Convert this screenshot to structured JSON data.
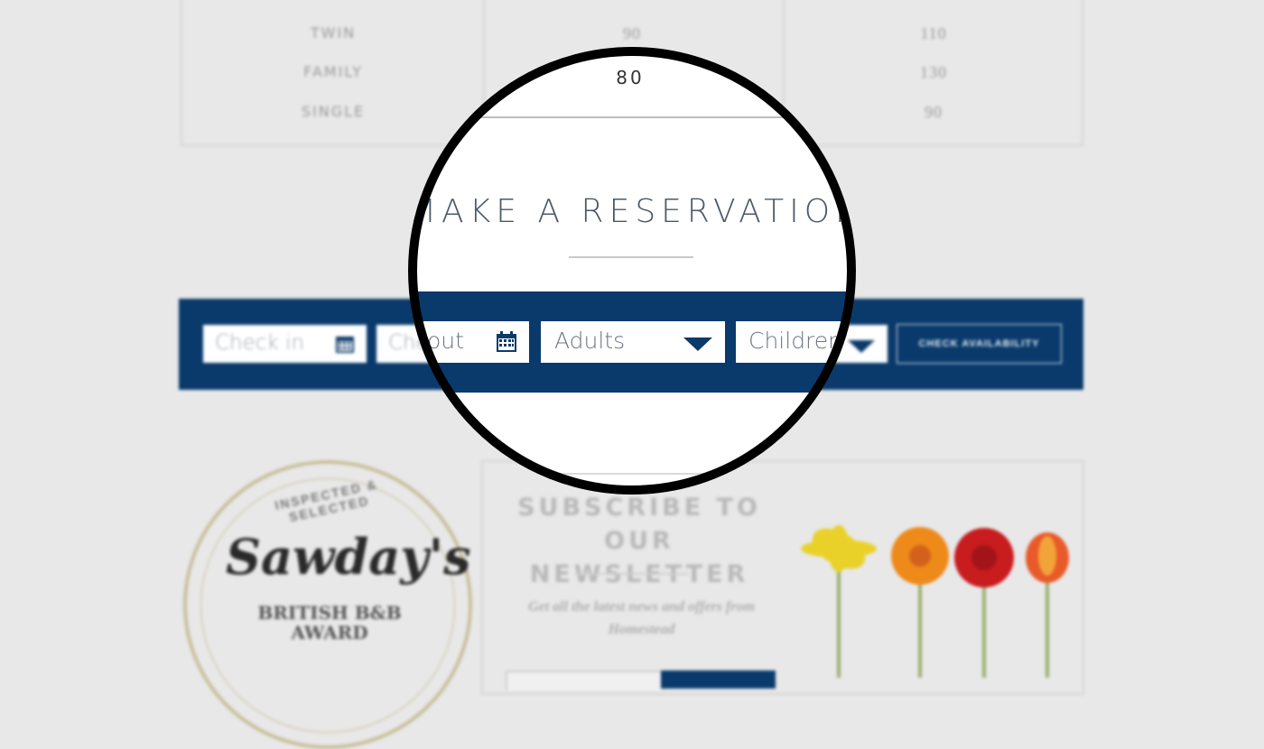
{
  "rates": {
    "rows": [
      {
        "room": "TWIN",
        "price1": "90",
        "price2": "110"
      },
      {
        "room": "FAMILY",
        "price1": "",
        "price2": "130"
      },
      {
        "room": "SINGLE",
        "price1": "",
        "price2": "90"
      }
    ],
    "highlight_price": "80"
  },
  "reservation": {
    "title": "MAKE A RESERVATION",
    "check_in_placeholder": "Check in",
    "check_out_placeholder": "Check out",
    "check_out_visible": "out",
    "check_out_blur": "Che",
    "adults_label": "Adults",
    "children_label": "Children",
    "button_label": "CHECK AVAILABILITY"
  },
  "award": {
    "top_text": "INSPECTED & SELECTED",
    "name": "Sawday's",
    "line1": "BRITISH B&B",
    "line2": "AWARD"
  },
  "newsletter": {
    "title": "SUBSCRIBE TO OUR NEWSLETTER",
    "text": "Get all the latest news and offers from Homestead"
  },
  "icons": [
    "calendar-icon",
    "dropdown-arrow-icon"
  ],
  "colors": {
    "navy": "#093a6b",
    "background": "#e8e8e8"
  }
}
